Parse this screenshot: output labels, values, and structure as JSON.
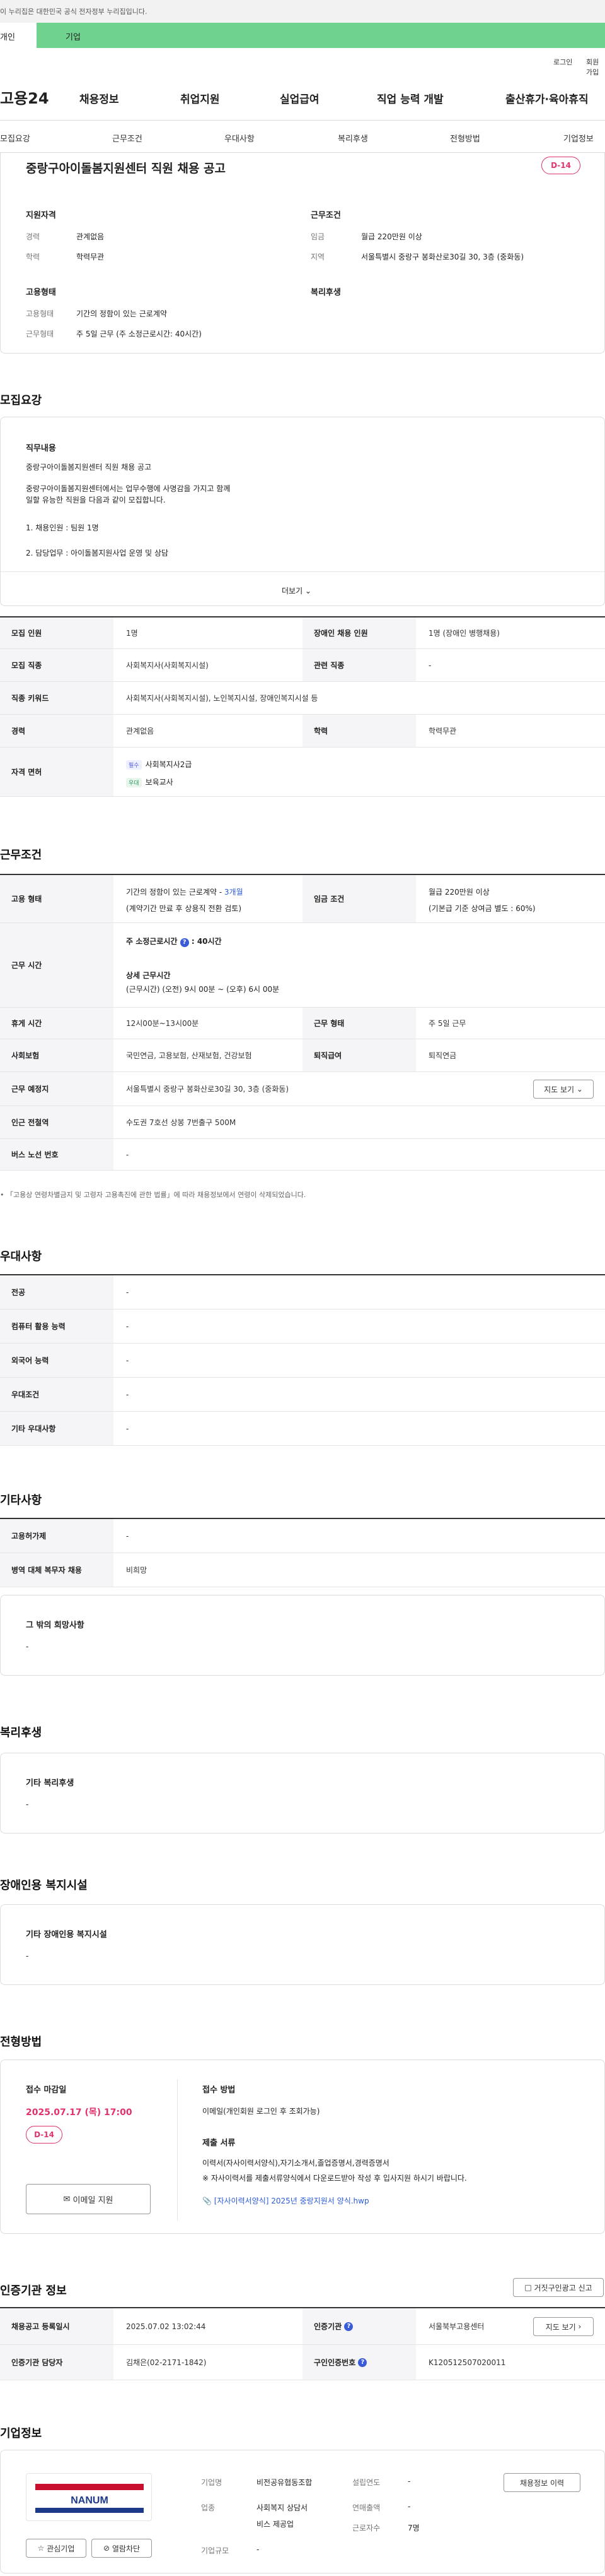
{
  "gov_banner": "이 누리집은 대한민국 공식 전자정부 누리집입니다.",
  "tabs": {
    "person": "개인",
    "company": "기업"
  },
  "util": {
    "login": "로그인",
    "signup": "회원가입"
  },
  "logo": "고용24",
  "gnb": [
    "채용정보",
    "취업지원",
    "실업급여",
    "직업 능력 개발",
    "출산휴가·육아휴직"
  ],
  "subnav": [
    "모집요강",
    "근무조건",
    "우대사항",
    "복리후생",
    "전형방법",
    "기업정보"
  ],
  "summary": {
    "title": "중랑구아이돌봄지원센터 직원 채용 공고",
    "dday": "D-14",
    "qual_head": "지원자격",
    "career_k": "경력",
    "career_v": "관계없음",
    "edu_k": "학력",
    "edu_v": "학력무관",
    "cond_head": "근무조건",
    "wage_k": "임금",
    "wage_v": "월급 220만원 이상",
    "loc_k": "지역",
    "loc_v": "서울특별시 중랑구 봉화산로30길 30, 3층 (중화동)",
    "emp_head": "고용형태",
    "emptype_k": "고용형태",
    "emptype_v": "기간의 정함이 있는 근로계약",
    "worktype_k": "근무형태",
    "worktype_v": "주 5일 근무 (주 소정근로시간: 40시간)",
    "welfare_head": "복리후생"
  },
  "recruit": {
    "heading": "모집요강",
    "job_head": "직무내용",
    "lines": [
      "중랑구아이돌봄지원센터 직원 채용 공고",
      "중랑구아이돌봄지원센터에서는 업무수행에 사명감을 가지고 함께",
      "일할 유능한 직원을 다음과 같이 모집합니다.",
      "1. 채용인원 : 팀원 1명",
      "2. 담당업무 : 아이돌봄지원사업 운영 및 상담"
    ],
    "more": "더보기",
    "table": {
      "count_k": "모집 인원",
      "count_v": "1명",
      "disabled_k": "장애인 채용 인원",
      "disabled_v": "1명 (장애인 병행채용)",
      "job_k": "모집 직종",
      "job_v": "사회복지사(사회복지시설)",
      "related_k": "관련 직종",
      "related_v": "-",
      "kw_k": "직종 키워드",
      "kw_v": "사회복지사(사회복지시설), 노인복지시설, 장애인복지시설 등",
      "career_k": "경력",
      "career_v": "관계없음",
      "edu_k": "학력",
      "edu_v": "학력무관",
      "lic_k": "자격 면허",
      "lic1_tag": "필수",
      "lic1": "사회복지사2급",
      "lic2_tag": "우대",
      "lic2": "보육교사"
    }
  },
  "workcond": {
    "heading": "근무조건",
    "emptype_k": "고용 형태",
    "emptype_v1a": "기간의 정함이 있는 근로계약 - ",
    "emptype_v1b": "3개월",
    "emptype_v2": "(계약기간 만료 후 상용직 전환 검토)",
    "wage_k": "임금 조건",
    "wage_v1": "월급 220만원 이상",
    "wage_v2": "(기본급 기준 상여금 별도 : 60%)",
    "hours_k": "근무 시간",
    "hours_v1": "주 소정근로시간",
    "hours_v1b": ": 40시간",
    "hours_v2": "상세 근무시간",
    "hours_v3": "(근무시간) (오전) 9시 00분 ~ (오후) 6시 00분",
    "break_k": "휴게 시간",
    "break_v": "12시00분~13시00분",
    "form_k": "근무 형태",
    "form_v": "주 5일 근무",
    "ins_k": "사회보험",
    "ins_v": "국민연금, 고용보험, 산재보험, 건강보험",
    "pension_k": "퇴직급여",
    "pension_v": "퇴직연금",
    "place_k": "근무 예정지",
    "place_v": "서울특별시 중랑구 봉화산로30길 30, 3층 (중화동)",
    "map_btn": "지도 보기",
    "subway_k": "인근 전철역",
    "subway_v": "수도권 7호선 상봉 7번출구 500M",
    "bus_k": "버스 노선 번호",
    "bus_v": "-",
    "note": "• 「고용상 연령차별금지 및 고령자 고용촉진에 관한 법률」에 따라 채용정보에서 연령이 삭제되었습니다."
  },
  "pref": {
    "heading": "우대사항",
    "rows": [
      {
        "k": "전공",
        "v": "-"
      },
      {
        "k": "컴퓨터 활용 능력",
        "v": "-"
      },
      {
        "k": "외국어 능력",
        "v": "-"
      },
      {
        "k": "우대조건",
        "v": "-"
      },
      {
        "k": "기타 우대사항",
        "v": "-"
      }
    ]
  },
  "etc": {
    "heading": "기타사항",
    "rows": [
      {
        "k": "고용허가제",
        "v": "-"
      },
      {
        "k": "병역 대체 복무자 채용",
        "v": "비희망"
      }
    ],
    "hope_head": "그 밖의 희망사항",
    "hope_v": "-"
  },
  "welfare": {
    "heading": "복리후생",
    "sub": "기타 복리후생",
    "v": "-"
  },
  "facility": {
    "heading": "장애인용 복지시설",
    "sub": "기타 장애인용 복지시설",
    "v": "-"
  },
  "process": {
    "heading": "전형방법",
    "deadline_k": "접수 마감일",
    "deadline_v": "2025.07.17 (목) 17:00",
    "dday": "D-14",
    "email_btn": "이메일 지원",
    "method_k": "접수 방법",
    "method_v": "이메일(개인회원 로그인 후 조회가능)",
    "docs_k": "제출 서류",
    "docs_v1": "이력서(자사이력서양식),자기소개서,졸업증명서,경력증명서",
    "docs_v2": "※ 자사이력서를 제출서류양식에서 다운로드받아 작성 후 입사지원 하시기 바랍니다.",
    "file": "[자사이력서양식] 2025년 중랑지원서 양식.hwp"
  },
  "agency": {
    "heading": "인증기관 정보",
    "report_btn": "거짓구인광고 신고",
    "reg_k": "채용공고 등록일시",
    "reg_v": "2025.07.02 13:02:44",
    "agency_k": "인증기관",
    "agency_v": "서울북부고용센터",
    "mgr_k": "인증기관 담당자",
    "mgr_v": "김채은(02-2171-1842)",
    "no_k": "구인인증번호",
    "no_v": "K120512507020011",
    "map_btn": "지도 보기"
  },
  "company": {
    "heading": "기업정보",
    "logo_text": "NANUM",
    "fav_btn": "관심기업",
    "block_btn": "열람차단",
    "name_k": "기업명",
    "name_v": "비전공유협동조합",
    "biz_k": "업종",
    "biz_v1": "사회복지 상담서",
    "biz_v2": "비스 제공업",
    "size_k": "기업규모",
    "size_v": "-",
    "est_k": "설립연도",
    "est_v": "-",
    "rev_k": "연매출액",
    "rev_v": "-",
    "emp_k": "근로자수",
    "emp_v": "7명",
    "jobs_btn": "채용정보 이력"
  },
  "colors": {
    "accent": "#e0336b",
    "tab_green": "#6fd28f",
    "link_blue": "#2b5cd8"
  }
}
